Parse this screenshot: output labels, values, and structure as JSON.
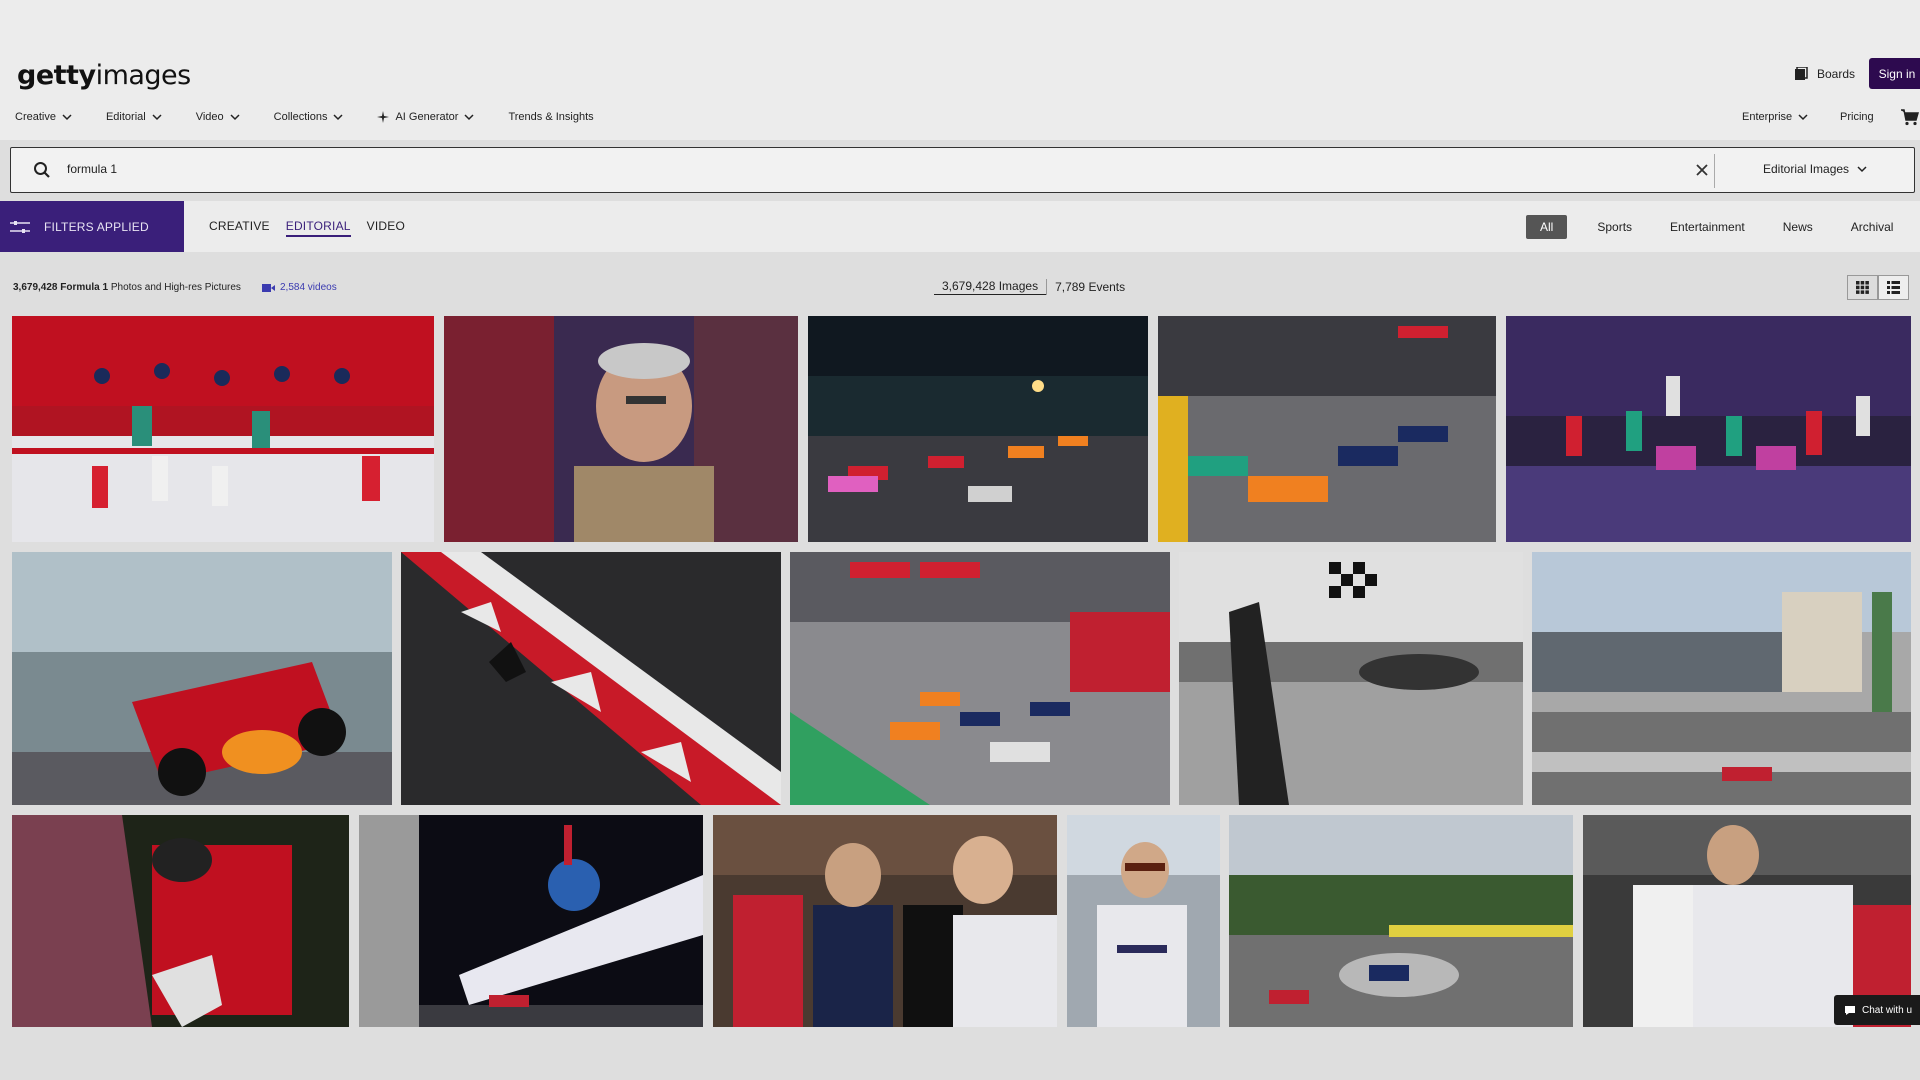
{
  "header": {
    "logo_bold": "getty",
    "logo_light": "images",
    "boards_label": "Boards",
    "signin_label": "Sign in"
  },
  "nav": {
    "items": [
      {
        "label": "Creative",
        "icon": "chevron-down-icon"
      },
      {
        "label": "Editorial",
        "icon": "chevron-down-icon"
      },
      {
        "label": "Video",
        "icon": "chevron-down-icon"
      },
      {
        "label": "Collections",
        "icon": "chevron-down-icon"
      },
      {
        "label": "AI Generator",
        "icon": "chevron-down-icon"
      },
      {
        "label": "Trends & Insights"
      }
    ],
    "enterprise_label": "Enterprise",
    "pricing_label": "Pricing"
  },
  "search": {
    "query": "formula 1",
    "scope_label": "Editorial Images"
  },
  "filterbar": {
    "filters_applied_label": "FILTERS APPLIED",
    "type_tabs": [
      "CREATIVE",
      "EDITORIAL",
      "VIDEO"
    ],
    "active_type_tab": "EDITORIAL",
    "categories": [
      "All",
      "Sports",
      "Entertainment",
      "News",
      "Archival"
    ],
    "active_category": "All"
  },
  "results": {
    "count_bold": "3,679,428 Formula 1",
    "count_rest": "Photos and High-res Pictures",
    "videos_label": "2,584 videos",
    "images_label": "3,679,428 Images",
    "events_label": "7,789 Events"
  },
  "chat_label": "Chat with u",
  "colors": {
    "accent_purple": "#3a1f7a",
    "signin_bg": "#2d0a4f",
    "link_blue": "#3b3bb0"
  }
}
